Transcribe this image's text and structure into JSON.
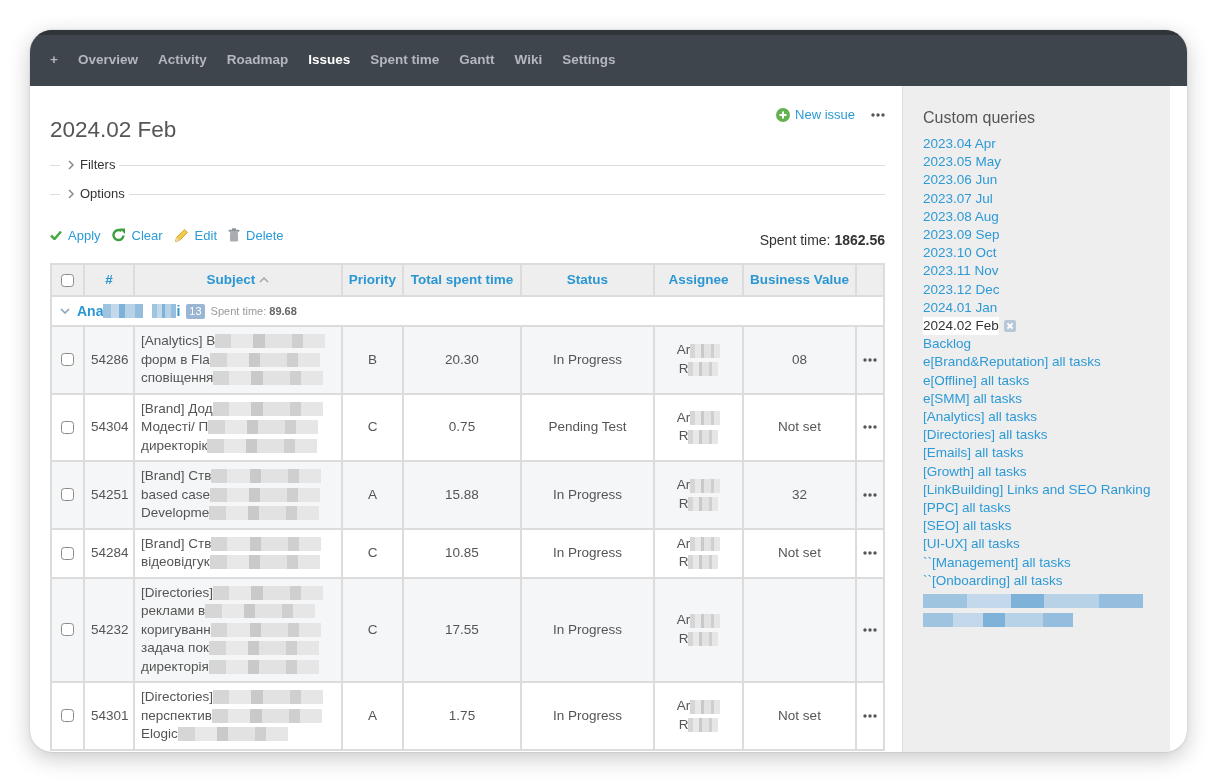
{
  "top_menu": {
    "new_menu": "+",
    "items": [
      {
        "label": "Overview",
        "selected": false
      },
      {
        "label": "Activity",
        "selected": false
      },
      {
        "label": "Roadmap",
        "selected": false
      },
      {
        "label": "Issues",
        "selected": true
      },
      {
        "label": "Spent time",
        "selected": false
      },
      {
        "label": "Gantt",
        "selected": false
      },
      {
        "label": "Wiki",
        "selected": false
      },
      {
        "label": "Settings",
        "selected": false
      }
    ]
  },
  "page": {
    "title": "2024.02 Feb",
    "new_issue": "New issue"
  },
  "fieldsets": [
    {
      "label": "Filters",
      "expanded": false
    },
    {
      "label": "Options",
      "expanded": false
    }
  ],
  "query_actions": [
    {
      "kind": "apply",
      "label": "Apply"
    },
    {
      "kind": "clear",
      "label": "Clear"
    },
    {
      "kind": "edit",
      "label": "Edit"
    },
    {
      "kind": "delete",
      "label": "Delete"
    }
  ],
  "total_spent": "Spent time: **1862.56**",
  "table": {
    "select_all_checked": false,
    "columns": [
      {
        "label": "#"
      },
      {
        "label": "Subject",
        "sort_ascending": true
      },
      {
        "label": "Priority"
      },
      {
        "label": "Total spent time"
      },
      {
        "label": "Status"
      },
      {
        "label": "Assignee"
      },
      {
        "label": "Business Value"
      }
    ],
    "group": {
      "expanded": true,
      "name_start": "Ana",
      "name_end": "i",
      "count": "13",
      "spent": "Spent time: **89.68**"
    },
    "rows": [
      {
        "checked": false,
        "id": "54286",
        "subject": [
          "[Analytics] В",
          "форм в Fla",
          "сповіщення"
        ],
        "priority": "B",
        "total_spent_time": "20.30",
        "status": "In Progress",
        "assignee": [
          "Ar",
          "R"
        ],
        "business_value": "08"
      },
      {
        "checked": false,
        "id": "54304",
        "subject": [
          "[Brand] Дод",
          "Модесті/ П",
          "директорік"
        ],
        "priority": "C",
        "total_spent_time": "0.75",
        "status": "Pending Test",
        "assignee": [
          "Ar",
          "R"
        ],
        "business_value": "Not set"
      },
      {
        "checked": false,
        "id": "54251",
        "subject": [
          "[Brand] Ств",
          "based case",
          "Developme"
        ],
        "priority": "A",
        "total_spent_time": "15.88",
        "status": "In Progress",
        "assignee": [
          "Ar",
          "R"
        ],
        "business_value": "32"
      },
      {
        "checked": false,
        "id": "54284",
        "subject": [
          "[Brand] Ств",
          "відеовідгук"
        ],
        "priority": "C",
        "total_spent_time": "10.85",
        "status": "In Progress",
        "assignee": [
          "Ar",
          "R"
        ],
        "business_value": "Not set"
      },
      {
        "checked": false,
        "id": "54232",
        "subject": [
          "[Directories]",
          "реклами в",
          "коригуванн",
          "задача пок",
          "директорія"
        ],
        "priority": "C",
        "total_spent_time": "17.55",
        "status": "In Progress",
        "assignee": [
          "Ar",
          "R"
        ]
      },
      {
        "checked": false,
        "id": "54301",
        "subject": [
          "[Directories]",
          "перспектив",
          "Elogic"
        ],
        "priority": "A",
        "total_spent_time": "1.75",
        "status": "In Progress",
        "assignee": [
          "Ar",
          "R"
        ],
        "business_value": "Not set"
      }
    ]
  },
  "sidebar": {
    "title": "Custom queries",
    "items": [
      {
        "label": "2023.04 Apr",
        "selected": false
      },
      {
        "label": "2023.05 May",
        "selected": false
      },
      {
        "label": "2023.06 Jun",
        "selected": false
      },
      {
        "label": "2023.07 Jul",
        "selected": false
      },
      {
        "label": "2023.08 Aug",
        "selected": false
      },
      {
        "label": "2023.09 Sep",
        "selected": false
      },
      {
        "label": "2023.10 Oct",
        "selected": false
      },
      {
        "label": "2023.11 Nov",
        "selected": false
      },
      {
        "label": "2023.12 Dec",
        "selected": false
      },
      {
        "label": "2024.01 Jan",
        "selected": false
      },
      {
        "label": "2024.02 Feb",
        "selected": true
      },
      {
        "label": "Backlog",
        "selected": false
      },
      {
        "label": "e[Brand&Reputation] all tasks",
        "selected": false
      },
      {
        "label": "e[Offline] all tasks",
        "selected": false
      },
      {
        "label": "e[SMM] all tasks",
        "selected": false
      },
      {
        "label": "[Analytics] all tasks",
        "selected": false
      },
      {
        "label": "[Directories] all tasks",
        "selected": false
      },
      {
        "label": "[Emails] all tasks",
        "selected": false
      },
      {
        "label": "[Growth] all tasks",
        "selected": false
      },
      {
        "label": "[LinkBuilding] Links and SEO Ranking",
        "selected": false
      },
      {
        "label": "[PPC] all tasks",
        "selected": false
      },
      {
        "label": "[SEO] all tasks",
        "selected": false
      },
      {
        "label": "[UI-UX] all tasks",
        "selected": false
      },
      {
        "label": "``[Management] all tasks",
        "selected": false
      },
      {
        "label": "``[Onboarding] all tasks",
        "selected": false
      }
    ],
    "redacted_entry": true
  }
}
